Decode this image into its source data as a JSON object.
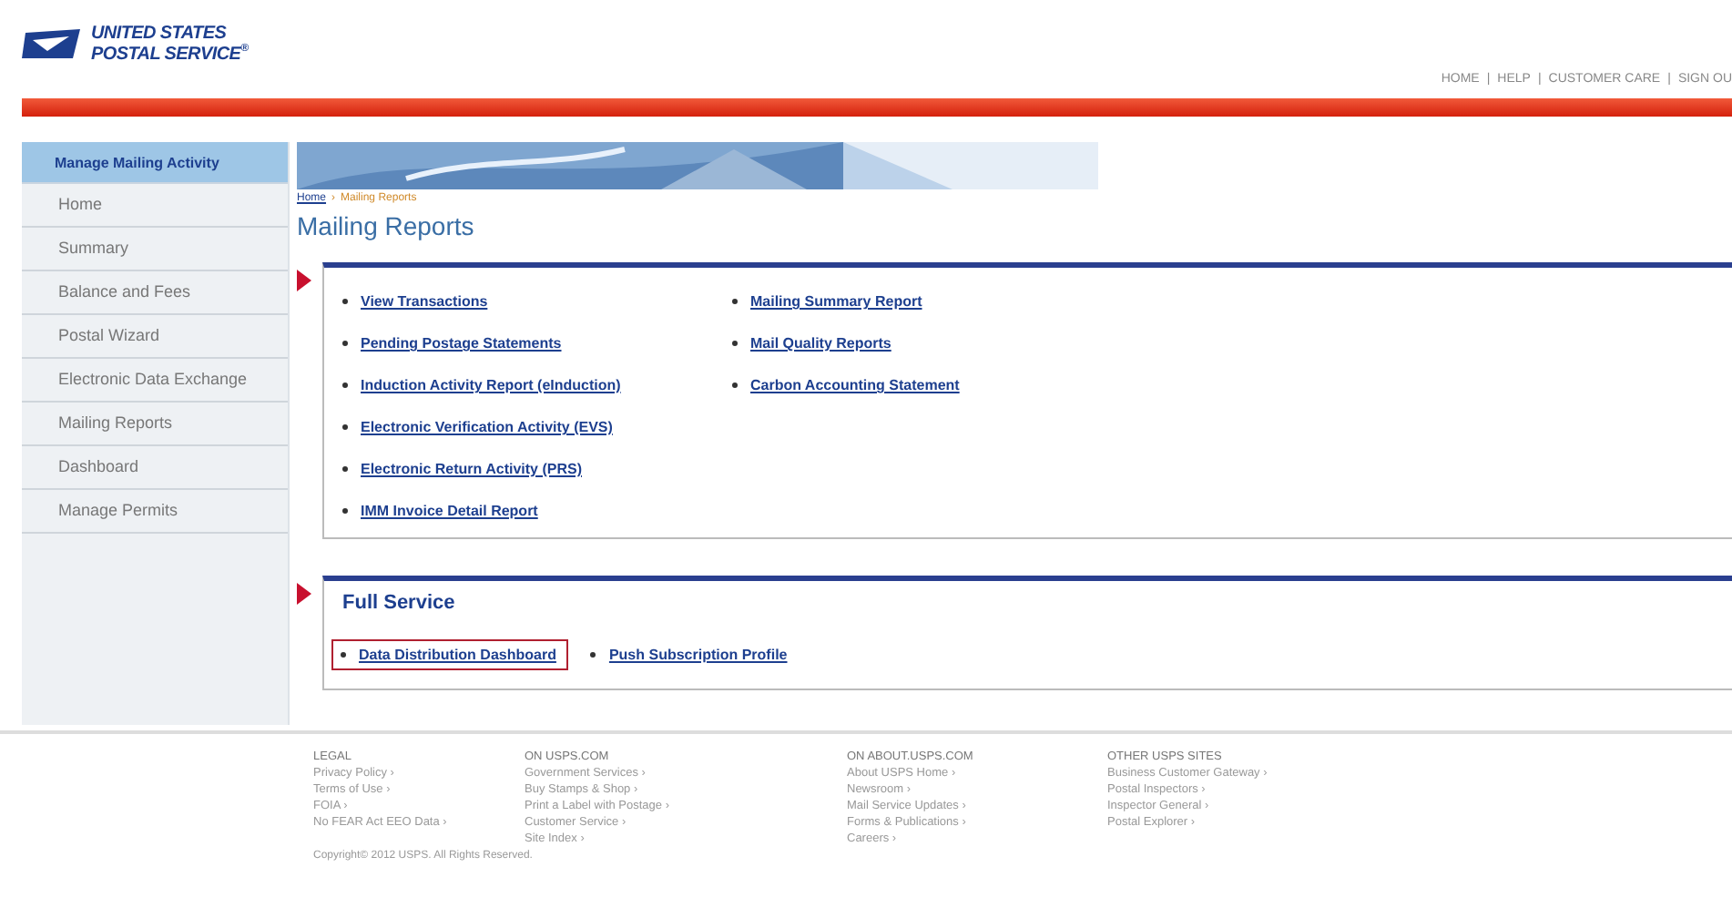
{
  "logo": {
    "line_1": "UNITED STATES",
    "line_2": "POSTAL SERVICE",
    "mark": "®"
  },
  "top_nav": {
    "separator": "|",
    "links": [
      "HOME",
      "HELP",
      "CUSTOMER CARE",
      "SIGN OU"
    ]
  },
  "sidebar": {
    "title": "Manage Mailing Activity",
    "items": [
      "Home",
      "Summary",
      "Balance and Fees",
      "Postal Wizard",
      "Electronic Data Exchange",
      "Mailing Reports",
      "Dashboard",
      "Manage Permits"
    ]
  },
  "breadcrumb": {
    "separator": "›",
    "items": [
      "Home",
      "Mailing Reports"
    ]
  },
  "page_title": "Mailing Reports",
  "sections": [
    {
      "columns": [
        [
          "View Transactions",
          "Pending Postage Statements",
          "Induction Activity Report (eInduction)",
          "Electronic Verification Activity (EVS)",
          "Electronic Return Activity (PRS)",
          "IMM Invoice Detail Report"
        ],
        [
          "Mailing Summary Report",
          "Mail Quality Reports",
          "Carbon Accounting Statement"
        ]
      ]
    },
    {
      "title": "Full Service",
      "links": [
        {
          "label": "Data Distribution Dashboard",
          "highlighted": true
        },
        {
          "label": "Push Subscription Profile",
          "highlighted": false
        }
      ]
    }
  ],
  "footer": {
    "columns": [
      {
        "heading": "LEGAL",
        "links": [
          "Privacy Policy ›",
          "Terms of Use ›",
          "FOIA ›",
          "No FEAR Act EEO Data ›"
        ]
      },
      {
        "heading": "ON USPS.COM",
        "links": [
          "Government Services ›",
          "Buy Stamps & Shop ›",
          "Print a Label with Postage ›",
          "Customer Service ›",
          "Site Index ›"
        ]
      },
      {
        "heading": "ON ABOUT.USPS.COM",
        "links": [
          "About USPS Home ›",
          "Newsroom ›",
          "Mail Service Updates ›",
          "Forms & Publications ›",
          "Careers ›"
        ]
      },
      {
        "heading": "OTHER USPS SITES",
        "links": [
          "Business Customer Gateway ›",
          "Postal Inspectors ›",
          "Inspector General ›",
          "Postal Explorer ›"
        ]
      }
    ],
    "copyright": "Copyright© 2012 USPS.  All Rights Reserved."
  }
}
